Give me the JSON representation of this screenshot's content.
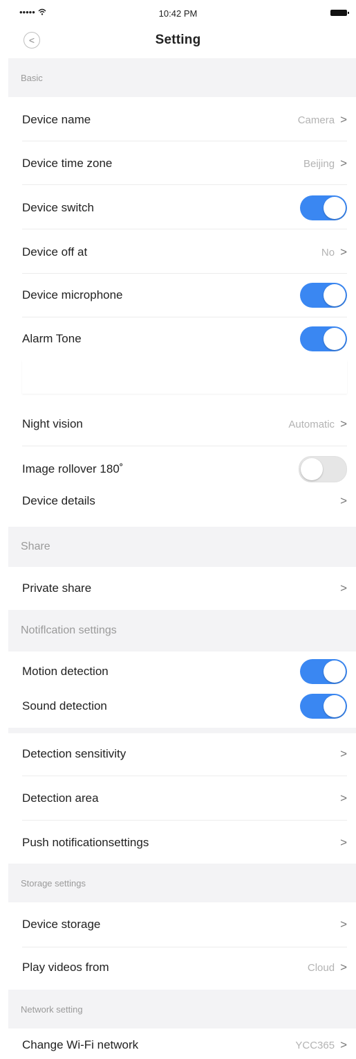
{
  "status_bar": {
    "signal": "•••••",
    "time": "10:42 PM"
  },
  "nav": {
    "back": "<",
    "title": "Setting"
  },
  "basic": {
    "header": "Basic",
    "device_name": {
      "label": "Device name",
      "value": "Camera"
    },
    "time_zone": {
      "label": "Device time zone",
      "value": "Beijing"
    },
    "device_switch": {
      "label": "Device switch",
      "state": true
    },
    "device_off_at": {
      "label": "Device off at",
      "value": "No"
    },
    "microphone": {
      "label": "Device microphone",
      "state": true
    },
    "alarm_tone": {
      "label": "Alarm Tone",
      "state": true
    },
    "night_vision": {
      "label": "Night vision",
      "value": "Automatic"
    },
    "image_rollover": {
      "label": "Image rollover 180˚",
      "state": false
    },
    "device_details": {
      "label": "Device details"
    }
  },
  "share": {
    "header": "Share",
    "private_share": {
      "label": "Private share"
    }
  },
  "notification": {
    "header": "Notiflcation settings",
    "motion": {
      "label": "Motion detection",
      "state": true
    },
    "sound": {
      "label": "Sound detection",
      "state": true
    },
    "sensitivity": {
      "label": "Detection sensitivity"
    },
    "area": {
      "label": "Detection area"
    },
    "push": {
      "label": "Push notificationsettings"
    }
  },
  "storage": {
    "header": "Storage settings",
    "device_storage": {
      "label": "Device storage"
    },
    "play_videos": {
      "label": "Play videos from",
      "value": "Cloud"
    }
  },
  "network": {
    "header": "Network setting",
    "wifi": {
      "label": "Change Wi-Fi network",
      "value": "YCC365"
    }
  },
  "chevron": ">",
  "colors": {
    "toggle_on": "#3a87f2",
    "section_bg": "#f3f3f5"
  }
}
